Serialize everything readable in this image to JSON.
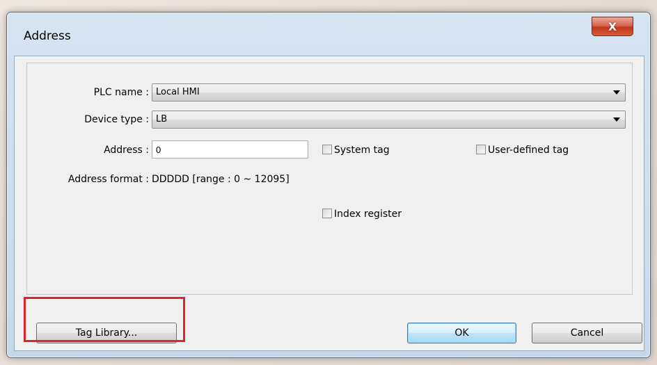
{
  "window": {
    "title": "Address",
    "close_label": "X"
  },
  "form": {
    "plc_name_label": "PLC name :",
    "plc_name_value": "Local HMI",
    "device_type_label": "Device type :",
    "device_type_value": "LB",
    "address_label": "Address :",
    "address_value": "0",
    "system_tag_label": "System tag",
    "system_tag_checked": false,
    "user_defined_tag_label": "User-defined tag",
    "user_defined_tag_checked": false,
    "address_format_label": "Address format :",
    "address_format_value": "DDDDD [range : 0 ~ 12095]",
    "index_register_label": "Index register",
    "index_register_checked": false
  },
  "buttons": {
    "tag_library": "Tag Library...",
    "ok": "OK",
    "cancel": "Cancel"
  },
  "colors": {
    "highlight": "#e0242c"
  }
}
